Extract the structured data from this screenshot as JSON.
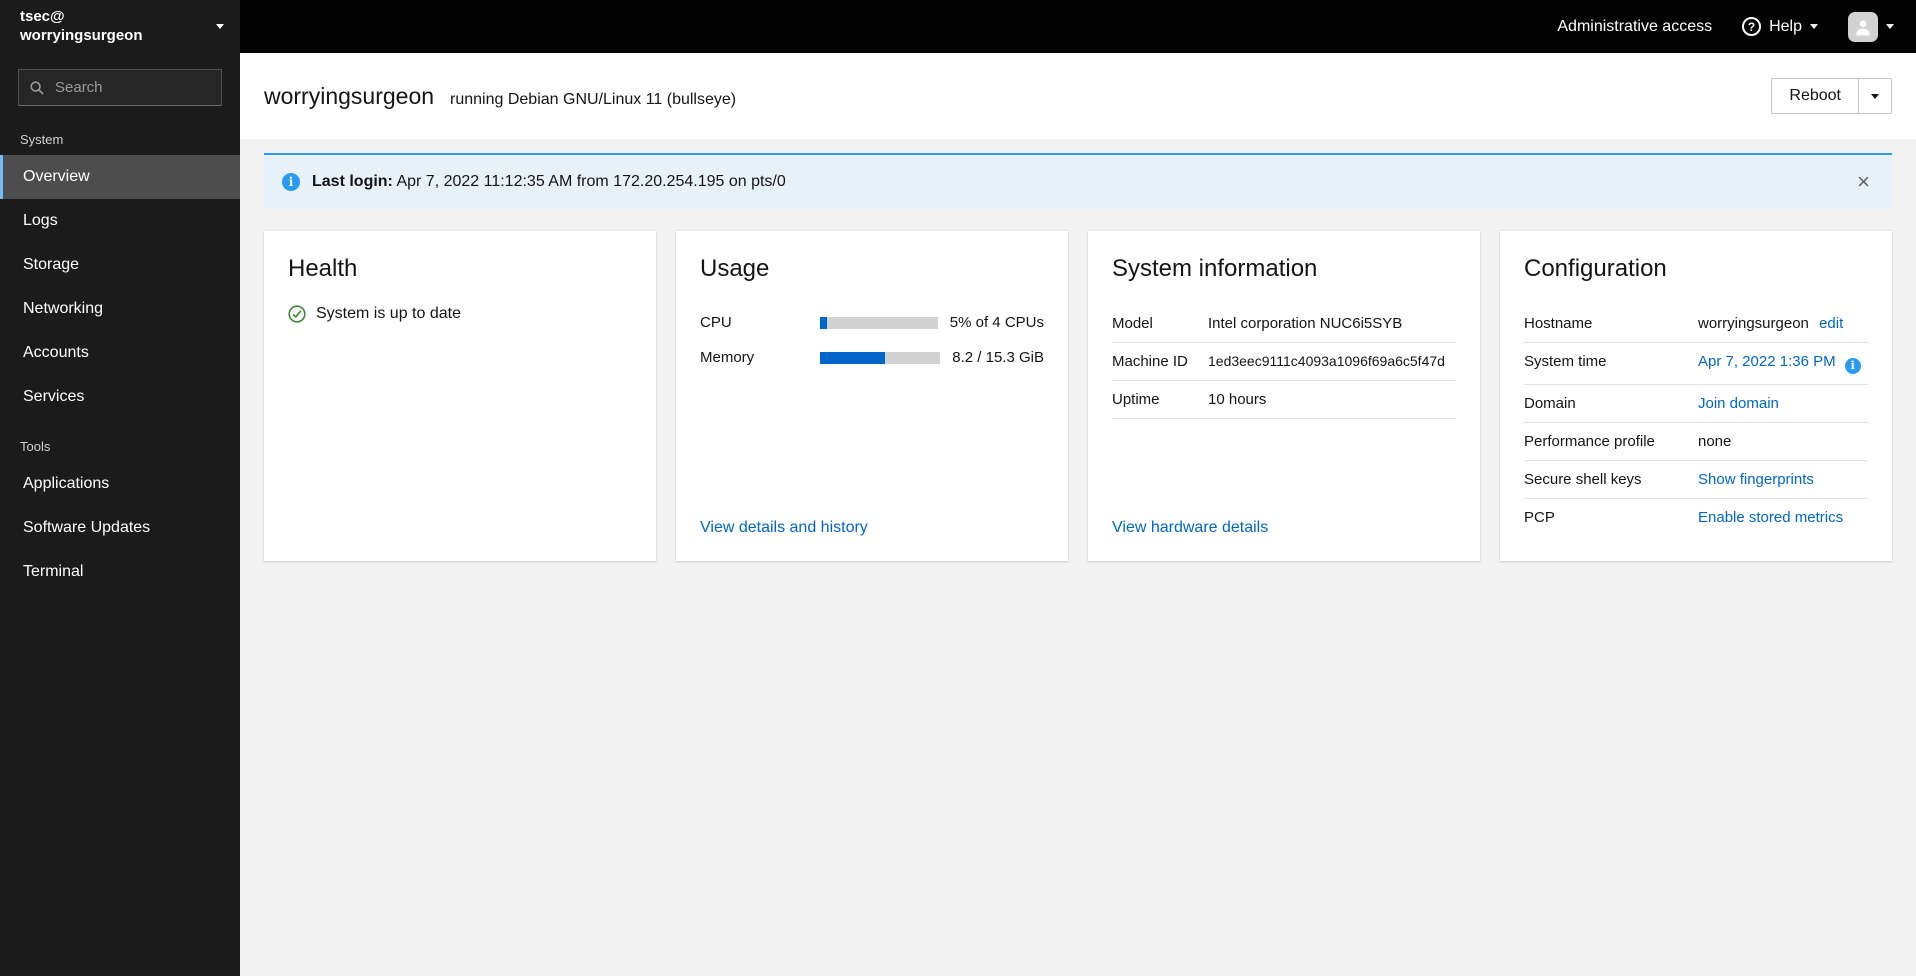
{
  "sidebar": {
    "user": "tsec@",
    "host": "worryingsurgeon",
    "search_placeholder": "Search",
    "selected_item": "Overview",
    "sections": [
      {
        "label": "System",
        "items": [
          "Overview",
          "Logs",
          "Storage",
          "Networking",
          "Accounts",
          "Services"
        ]
      },
      {
        "label": "Tools",
        "items": [
          "Applications",
          "Software Updates",
          "Terminal"
        ]
      }
    ]
  },
  "topbar": {
    "admin_access": "Administrative access",
    "help_label": "Help"
  },
  "page_header": {
    "hostname": "worryingsurgeon",
    "subtitle": "running Debian GNU/Linux 11 (bullseye)",
    "reboot_label": "Reboot"
  },
  "alert": {
    "label": "Last login:",
    "message": "Apr 7, 2022 11:12:35 AM from 172.20.254.195 on pts/0",
    "close_icon": "×"
  },
  "health": {
    "title": "Health",
    "status": "System is up to date"
  },
  "usage": {
    "title": "Usage",
    "cpu": {
      "label": "CPU",
      "value": "5% of 4 CPUs",
      "percent": 6
    },
    "memory": {
      "label": "Memory",
      "value": "8.2 / 15.3 GiB",
      "percent": 54
    },
    "link": "View details and history"
  },
  "system_info": {
    "title": "System information",
    "rows": [
      {
        "label": "Model",
        "value": "Intel corporation NUC6i5SYB"
      },
      {
        "label": "Machine ID",
        "value": "1ed3eec9111c4093a1096f69a6c5f47d"
      },
      {
        "label": "Uptime",
        "value": "10 hours"
      }
    ],
    "link": "View hardware details"
  },
  "configuration": {
    "title": "Configuration",
    "hostname": {
      "label": "Hostname",
      "value": "worryingsurgeon",
      "action": "edit"
    },
    "system_time": {
      "label": "System time",
      "value": "Apr 7, 2022 1:36 PM"
    },
    "domain": {
      "label": "Domain",
      "action": "Join domain"
    },
    "performance": {
      "label": "Performance profile",
      "value": "none"
    },
    "ssh_keys": {
      "label": "Secure shell keys",
      "action": "Show fingerprints"
    },
    "pcp": {
      "label": "PCP",
      "action": "Enable stored metrics"
    }
  },
  "colors": {
    "accent_link": "#0066cc",
    "info_blue": "#2b9af3",
    "success_green": "#3e8635",
    "nav_selected_border": "#73bcf7"
  }
}
